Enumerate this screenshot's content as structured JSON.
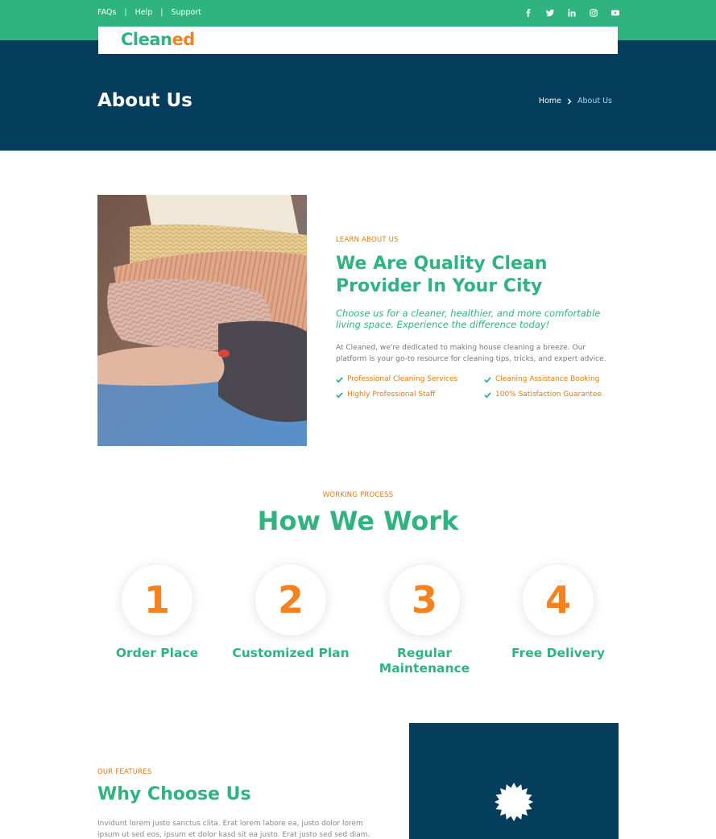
{
  "topbar": {
    "links": [
      "FAQs",
      "Help",
      "Support"
    ],
    "separator": "|",
    "social_icons": [
      "facebook-icon",
      "twitter-icon",
      "linkedin-icon",
      "instagram-icon",
      "youtube-icon"
    ],
    "background": "#2fb380"
  },
  "logo": {
    "part1": "Clean",
    "part2": "ed"
  },
  "hero": {
    "title": "About Us",
    "breadcrumb": {
      "home": "Home",
      "current": "About Us"
    },
    "background": "#053e5c"
  },
  "about": {
    "eyebrow": "LEARN ABOUT US",
    "heading": "We Are Quality Clean Provider In Your City",
    "lead": "Choose us for a cleaner, healthier, and more comfortable living space. Experience the difference today!",
    "body": "At Cleaned, we're dedicated to making house cleaning a breeze. Our platform is your go-to resource for cleaning tips, tricks, and expert advice.",
    "features": [
      "Professional Cleaning Services",
      "Cleaning Assistance Booking",
      "Highly Professional Staff",
      "100% Satisfaction Guarantee"
    ]
  },
  "work": {
    "eyebrow": "WORKING PROCESS",
    "heading": "How We Work",
    "steps": [
      {
        "number": "1",
        "label": "Order Place"
      },
      {
        "number": "2",
        "label": "Customized Plan"
      },
      {
        "number": "3",
        "label": "Regular Maintenance"
      },
      {
        "number": "4",
        "label": "Free Delivery"
      }
    ]
  },
  "why": {
    "eyebrow": "OUR FEATURES",
    "heading": "Why Choose Us",
    "body": "Invidunt lorem justo sanctus clita. Erat lorem labore ea, justo dolor lorem ipsum ut sed eos, ipsum et dolor kasd sit ea justo. Erat justo sed sed diam. Ea et erat ut"
  },
  "colors": {
    "accent": "#2fb380",
    "orange": "#f6821f",
    "navy": "#053e5c"
  }
}
